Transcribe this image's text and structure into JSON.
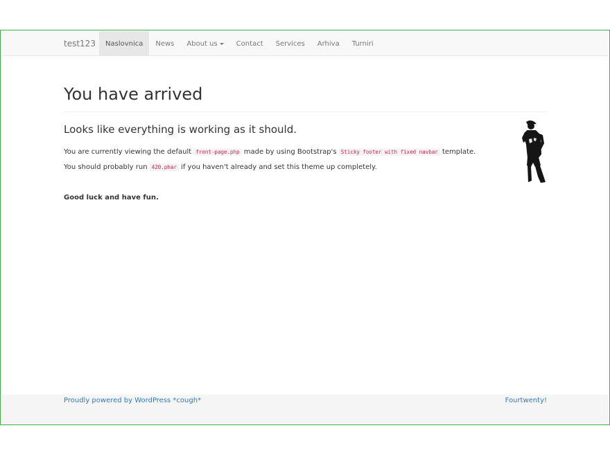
{
  "navbar": {
    "brand": "test123",
    "items": [
      {
        "label": "Naslovnica",
        "active": true
      },
      {
        "label": "News"
      },
      {
        "label": "About us",
        "dropdown": true
      },
      {
        "label": "Contact"
      },
      {
        "label": "Services"
      },
      {
        "label": "Arhiva"
      },
      {
        "label": "Turniri"
      }
    ]
  },
  "main": {
    "title": "You have arrived",
    "lead": "Looks like everything is working as it should.",
    "p1": {
      "t1": "You are currently viewing the default ",
      "code1": "front-page.php",
      "t2": " made by using Bootstrap's ",
      "code2": "Sticky footer with fixed navbar",
      "t3": " template."
    },
    "p2": {
      "t1": "You should probably run ",
      "code1": "420.phar",
      "t2": " if you haven't already and set this theme up completely."
    },
    "p3": "Good luck and have fun."
  },
  "footer": {
    "left": "Proudly powered by WordPress *cough*",
    "right": "Fourtwenty!"
  },
  "colors": {
    "frame_border": "#3cb043",
    "navbar_bg": "#f8f8f8",
    "active_bg": "#e7e7e7",
    "link": "#337ab7",
    "code_text": "#c7254e",
    "footer_bg": "#f5f5f5"
  }
}
